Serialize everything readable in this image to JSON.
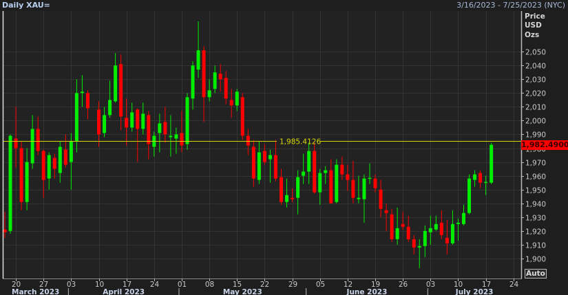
{
  "header": {
    "title": "Daily XAU=",
    "date_range": "3/16/2023 - 7/25/2023 (NYC)"
  },
  "axis_units": [
    "Price",
    "USD",
    "Ozs"
  ],
  "auto_button": "Auto",
  "last_price_label": "1,982.4900",
  "colors": {
    "up": "#00ee00",
    "down": "#ff0000",
    "reference_line": "#d8d800",
    "grid": "#343434",
    "background": "#222223"
  },
  "chart_data": {
    "type": "candlestick",
    "title": "Daily XAU=",
    "ylabel": "Price USD Ozs",
    "ylim": [
      1885.5,
      2079.5
    ],
    "y_ticks": [
      1900,
      1910,
      1920,
      1930,
      1940,
      1950,
      1960,
      1970,
      1980,
      1990,
      2000,
      2010,
      2020,
      2030,
      2040,
      2050
    ],
    "y_tick_labels": [
      "1,900",
      "1,910",
      "1,920",
      "1,930",
      "1,940",
      "1,950",
      "1,960",
      "1,970",
      "1,980",
      "1,990",
      "2,000",
      "2,010",
      "2,020",
      "2,030",
      "2,040",
      "2,050"
    ],
    "x_ticks": [
      {
        "date": "2023-03-20",
        "label": "20"
      },
      {
        "date": "2023-03-27",
        "label": "27"
      },
      {
        "date": "2023-04-03",
        "label": "03"
      },
      {
        "date": "2023-04-10",
        "label": "10"
      },
      {
        "date": "2023-04-17",
        "label": "17"
      },
      {
        "date": "2023-04-24",
        "label": "24"
      },
      {
        "date": "2023-05-01",
        "label": "01"
      },
      {
        "date": "2023-05-08",
        "label": "08"
      },
      {
        "date": "2023-05-15",
        "label": "15"
      },
      {
        "date": "2023-05-22",
        "label": "22"
      },
      {
        "date": "2023-05-29",
        "label": "29"
      },
      {
        "date": "2023-06-05",
        "label": "05"
      },
      {
        "date": "2023-06-12",
        "label": "12"
      },
      {
        "date": "2023-06-19",
        "label": "19"
      },
      {
        "date": "2023-06-26",
        "label": "26"
      },
      {
        "date": "2023-07-03",
        "label": "03"
      },
      {
        "date": "2023-07-10",
        "label": "10"
      },
      {
        "date": "2023-07-17",
        "label": "17"
      },
      {
        "date": "2023-07-24",
        "label": "24"
      }
    ],
    "months": [
      {
        "label": "March 2023",
        "start": "2023-03-16",
        "end": "2023-03-31"
      },
      {
        "label": "April 2023",
        "start": "2023-04-03",
        "end": "2023-04-28"
      },
      {
        "label": "May 2023",
        "start": "2023-05-01",
        "end": "2023-05-31"
      },
      {
        "label": "June 2023",
        "start": "2023-06-01",
        "end": "2023-06-30"
      },
      {
        "label": "July 2023",
        "start": "2023-07-03",
        "end": "2023-07-25"
      }
    ],
    "reference_line": {
      "value": 1985.4126,
      "label": "1,985.4126"
    },
    "last_price": 1982.49,
    "candle_fields": [
      "date",
      "open",
      "high",
      "low",
      "close"
    ],
    "candles": [
      [
        "2023-03-16",
        1921,
        1934,
        1915,
        1919
      ],
      [
        "2023-03-17",
        1920,
        1990,
        1918,
        1989
      ],
      [
        "2023-03-20",
        1987,
        2010,
        1966,
        1980
      ],
      [
        "2023-03-21",
        1980,
        1985,
        1935,
        1941
      ],
      [
        "2023-03-22",
        1941,
        1980,
        1935,
        1970
      ],
      [
        "2023-03-23",
        1969,
        2004,
        1965,
        1994
      ],
      [
        "2023-03-24",
        1994,
        2003,
        1975,
        1978
      ],
      [
        "2023-03-27",
        1978,
        1979,
        1944,
        1957
      ],
      [
        "2023-03-28",
        1958,
        1977,
        1950,
        1975
      ],
      [
        "2023-03-29",
        1973,
        1976,
        1958,
        1965
      ],
      [
        "2023-03-30",
        1962,
        1985,
        1955,
        1981
      ],
      [
        "2023-03-31",
        1979,
        1990,
        1966,
        1968
      ],
      [
        "2023-04-03",
        1970,
        1991,
        1950,
        1985
      ],
      [
        "2023-04-04",
        1985,
        2030,
        1977,
        2020
      ],
      [
        "2023-04-05",
        2020,
        2033,
        2010,
        2021
      ],
      [
        "2023-04-06",
        2020,
        2022,
        2001,
        2009
      ],
      [
        "2023-04-10",
        2008,
        2014,
        1981,
        1990
      ],
      [
        "2023-04-11",
        1991,
        2010,
        1988,
        2004
      ],
      [
        "2023-04-12",
        2004,
        2029,
        2002,
        2015
      ],
      [
        "2023-04-13",
        2014,
        2049,
        2013,
        2040
      ],
      [
        "2023-04-14",
        2041,
        2048,
        1993,
        2003
      ],
      [
        "2023-04-17",
        2002,
        2016,
        1982,
        1995
      ],
      [
        "2023-04-18",
        1995,
        2013,
        1992,
        2006
      ],
      [
        "2023-04-19",
        2008,
        2009,
        1970,
        1994
      ],
      [
        "2023-04-20",
        1994,
        2013,
        1990,
        2005
      ],
      [
        "2023-04-21",
        2004,
        2007,
        1972,
        1983
      ],
      [
        "2023-04-24",
        1981,
        1992,
        1974,
        1989
      ],
      [
        "2023-04-25",
        1991,
        2005,
        1977,
        1998
      ],
      [
        "2023-04-26",
        1999,
        2010,
        1984,
        1990
      ],
      [
        "2023-04-27",
        1988,
        2004,
        1974,
        1989
      ],
      [
        "2023-04-28",
        1987,
        1995,
        1976,
        1990
      ],
      [
        "2023-05-01",
        1991,
        2007,
        1977,
        1982
      ],
      [
        "2023-05-02",
        1983,
        2020,
        1979,
        2017
      ],
      [
        "2023-05-03",
        2016,
        2043,
        2008,
        2040
      ],
      [
        "2023-05-04",
        2037,
        2072,
        2031,
        2051
      ],
      [
        "2023-05-05",
        2051,
        2054,
        1999,
        2017
      ],
      [
        "2023-05-08",
        2017,
        2030,
        2014,
        2022
      ],
      [
        "2023-05-09",
        2023,
        2040,
        2020,
        2035
      ],
      [
        "2023-05-10",
        2034,
        2041,
        2021,
        2030
      ],
      [
        "2023-05-11",
        2031,
        2036,
        2012,
        2016
      ],
      [
        "2023-05-12",
        2015,
        2023,
        2002,
        2011
      ],
      [
        "2023-05-15",
        2011,
        2023,
        2007,
        2021
      ],
      [
        "2023-05-16",
        2017,
        2020,
        1986,
        1989
      ],
      [
        "2023-05-17",
        1989,
        1994,
        1975,
        1982
      ],
      [
        "2023-05-18",
        1981,
        1986,
        1952,
        1958
      ],
      [
        "2023-05-19",
        1957,
        1985,
        1954,
        1977
      ],
      [
        "2023-05-22",
        1978,
        1983,
        1968,
        1970
      ],
      [
        "2023-05-23",
        1972,
        1979,
        1955,
        1975
      ],
      [
        "2023-05-24",
        1975,
        1986,
        1956,
        1958
      ],
      [
        "2023-05-25",
        1959,
        1965,
        1939,
        1941
      ],
      [
        "2023-05-26",
        1941,
        1958,
        1937,
        1946
      ],
      [
        "2023-05-29",
        1944,
        1951,
        1941,
        1943
      ],
      [
        "2023-05-30",
        1944,
        1964,
        1932,
        1959
      ],
      [
        "2023-05-31",
        1960,
        1976,
        1954,
        1963
      ],
      [
        "2023-06-01",
        1963,
        1984,
        1954,
        1978
      ],
      [
        "2023-06-02",
        1978,
        1984,
        1947,
        1948
      ],
      [
        "2023-06-05",
        1948,
        1965,
        1939,
        1962
      ],
      [
        "2023-06-06",
        1962,
        1967,
        1954,
        1964
      ],
      [
        "2023-06-07",
        1964,
        1972,
        1940,
        1940
      ],
      [
        "2023-06-08",
        1941,
        1972,
        1940,
        1968
      ],
      [
        "2023-06-09",
        1968,
        1974,
        1957,
        1961
      ],
      [
        "2023-06-12",
        1961,
        1968,
        1949,
        1957
      ],
      [
        "2023-06-13",
        1957,
        1971,
        1940,
        1944
      ],
      [
        "2023-06-14",
        1943,
        1960,
        1940,
        1944
      ],
      [
        "2023-06-15",
        1943,
        1961,
        1926,
        1958
      ],
      [
        "2023-06-16",
        1958,
        1969,
        1954,
        1958.5
      ],
      [
        "2023-06-19",
        1958,
        1961,
        1948,
        1951
      ],
      [
        "2023-06-20",
        1950,
        1957,
        1930,
        1936
      ],
      [
        "2023-06-21",
        1935,
        1940,
        1920,
        1933
      ],
      [
        "2023-06-22",
        1932,
        1936,
        1912,
        1914
      ],
      [
        "2023-06-23",
        1914,
        1937,
        1910,
        1922
      ],
      [
        "2023-06-26",
        1925,
        1934,
        1921,
        1923
      ],
      [
        "2023-06-27",
        1923,
        1931,
        1912,
        1914
      ],
      [
        "2023-06-28",
        1914,
        1917,
        1903,
        1908
      ],
      [
        "2023-06-29",
        1908,
        1914,
        1893,
        1909
      ],
      [
        "2023-06-30",
        1909,
        1924,
        1901,
        1920
      ],
      [
        "2023-07-03",
        1919,
        1931,
        1910,
        1922
      ],
      [
        "2023-07-04",
        1921,
        1931,
        1920,
        1925
      ],
      [
        "2023-07-05",
        1926,
        1935,
        1914,
        1917
      ],
      [
        "2023-07-06",
        1915,
        1928,
        1903,
        1911
      ],
      [
        "2023-07-07",
        1911,
        1935,
        1910,
        1925
      ],
      [
        "2023-07-10",
        1925,
        1929,
        1913,
        1926
      ],
      [
        "2023-07-11",
        1925,
        1939,
        1924,
        1933
      ],
      [
        "2023-07-12",
        1933,
        1961,
        1932,
        1958
      ],
      [
        "2023-07-13",
        1957,
        1964,
        1952,
        1961
      ],
      [
        "2023-07-14",
        1962,
        1964,
        1951,
        1955
      ],
      [
        "2023-07-17",
        1955,
        1960,
        1946,
        1955.5
      ],
      [
        "2023-07-18",
        1955,
        1984,
        1954,
        1982.49
      ]
    ]
  }
}
